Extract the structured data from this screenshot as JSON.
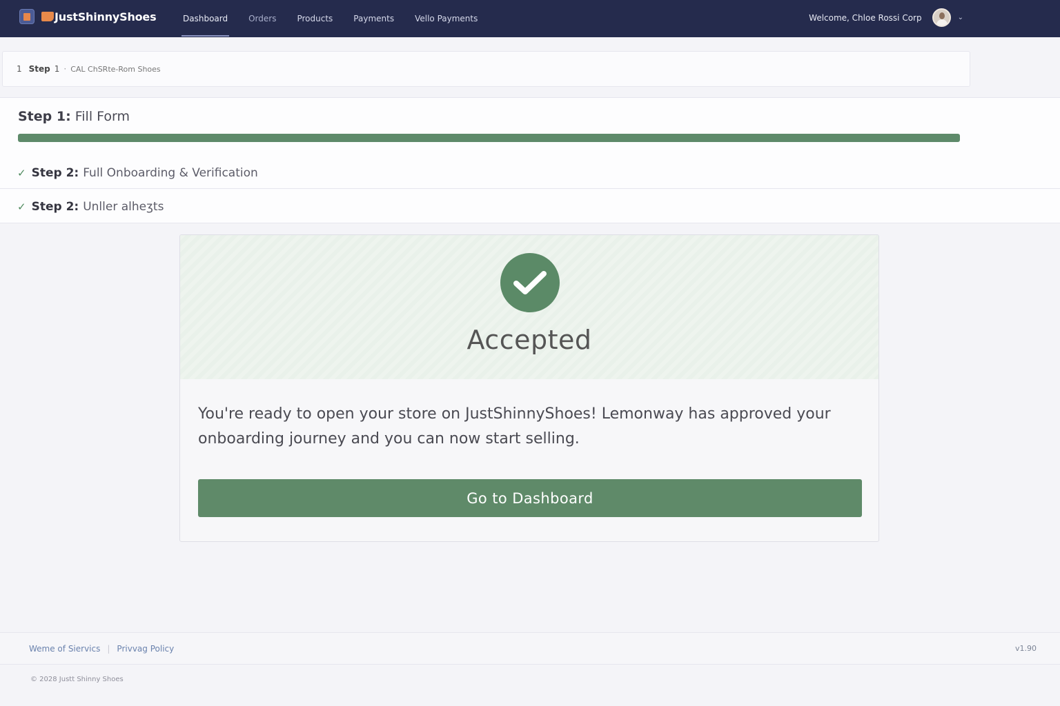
{
  "header": {
    "brand": "JustShinnyShoes",
    "nav": [
      "Dashboard",
      "Orders",
      "Products",
      "Payments",
      "Vello Payments"
    ],
    "welcome": "Welcome, Chloe Rossi Corp",
    "icons": {
      "logo": "app-logo-icon",
      "shoe": "shoe-icon",
      "avatar": "user-avatar",
      "chevron": "chevron-down-icon"
    },
    "colors": {
      "bar": "#252b4d",
      "accent": "#e8874a"
    }
  },
  "breadcrumb": {
    "number": "1",
    "step": "Step",
    "step_num": "1",
    "separator": "·",
    "text": "CAL ChSRte-Rom Shoes"
  },
  "steps": {
    "step1": {
      "label": "Step 1:",
      "title": "Fill Form",
      "progress": 1.0
    },
    "step2": {
      "label": "Step 2:",
      "title": "Full Onboarding & Verification",
      "icon": "check-icon"
    },
    "step3": {
      "label": "Step 2:",
      "title": "Unller alheʒts",
      "icon": "check-icon"
    }
  },
  "result": {
    "status": "Accepted",
    "status_icon": "check-circle-icon",
    "message": "You're ready to open your store on JustShinnyShoes! Lemonway has approved your onboarding journey and you can now start selling.",
    "button": "Go to Dashboard",
    "color": "#5e8a6a"
  },
  "footer": {
    "links": [
      "Weme of Siervics",
      "Privvag Policy"
    ],
    "version": "v1.90",
    "copyright": "© 2028 Justt Shinny Shoes"
  }
}
